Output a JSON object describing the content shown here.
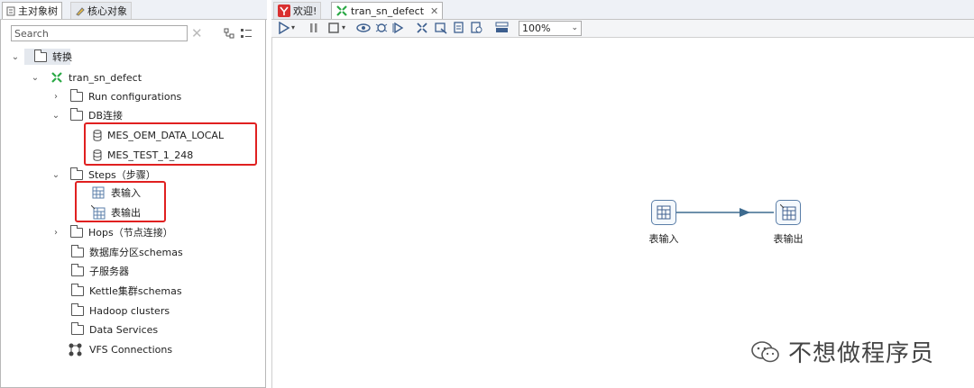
{
  "left_tabs": [
    {
      "label": "主对象树",
      "active": true
    },
    {
      "label": "核心对象",
      "active": false
    }
  ],
  "search": {
    "placeholder": "Search"
  },
  "tree": {
    "root": "转换",
    "transformation": "tran_sn_defect",
    "run_configurations": "Run configurations",
    "db_connections": "DB连接",
    "db_items": [
      "MES_OEM_DATA_LOCAL",
      "MES_TEST_1_248"
    ],
    "steps": "Steps（步骤）",
    "step_items": [
      "表输入",
      "表输出"
    ],
    "hops": "Hops（节点连接）",
    "partition_schemas": "数据库分区schemas",
    "slave_servers": "子服务器",
    "kettle_cluster": "Kettle集群schemas",
    "hadoop": "Hadoop clusters",
    "data_services": "Data Services",
    "vfs": "VFS Connections"
  },
  "editor_tabs": [
    {
      "label": "欢迎!",
      "icon": "welcome-icon"
    },
    {
      "label": "tran_sn_defect",
      "icon": "transformation-icon",
      "closable": true
    }
  ],
  "toolbar": {
    "zoom": "100%"
  },
  "canvas": {
    "steps": [
      "表输入",
      "表输出"
    ]
  },
  "watermark": "不想做程序员",
  "colors": {
    "accent_green": "#2aa845",
    "red_highlight": "#e02020",
    "step_border": "#5a7ea8"
  }
}
